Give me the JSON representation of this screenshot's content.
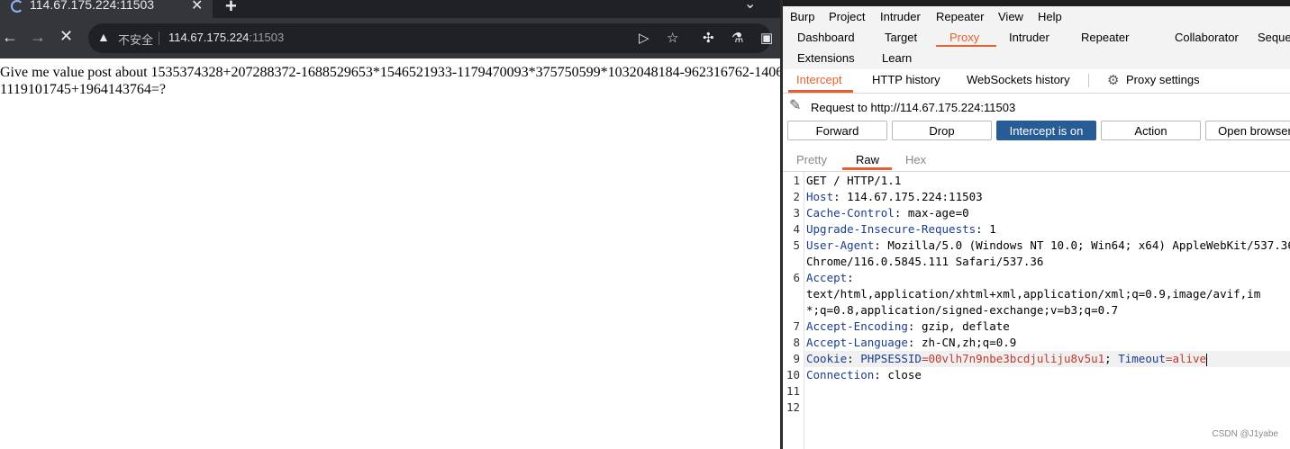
{
  "browser": {
    "tab": {
      "title": "114.67.175.224:11503"
    },
    "new_tab_label": "+",
    "tab_menu_label": "⌄",
    "toolbar": {
      "back_label": "←",
      "forward_label": "→",
      "stop_label": "✕"
    },
    "omnibox": {
      "security_label": "不安全",
      "url_host": "114.67.175.224",
      "url_port": ":11503"
    },
    "page": {
      "challenge_line1": "Give me value post about 1535374328+207288372-1688529653*1546521933-1179470093*375750599*1032048184-962316762-1406",
      "challenge_line2": "1119101745+1964143764=?"
    }
  },
  "burp": {
    "menu": [
      "Burp",
      "Project",
      "Intruder",
      "Repeater",
      "View",
      "Help"
    ],
    "tools_row1": [
      "Dashboard",
      "Target",
      "Proxy",
      "Intruder",
      "Repeater",
      "Collaborator",
      "Seque"
    ],
    "tools_row2": [
      "Extensions",
      "Learn"
    ],
    "active_tool": "Proxy",
    "proxy_tabs": [
      "Intercept",
      "HTTP history",
      "WebSockets history"
    ],
    "proxy_settings_label": "Proxy settings",
    "request_label": "Request to http://114.67.175.224:11503",
    "buttons": {
      "forward": "Forward",
      "drop": "Drop",
      "intercept": "Intercept is on",
      "action": "Action",
      "open_browser": "Open browser"
    },
    "view_tabs": [
      "Pretty",
      "Raw",
      "Hex"
    ],
    "lines": [
      {
        "n": "1",
        "name": "",
        "sep": "",
        "value": "GET / HTTP/1.1"
      },
      {
        "n": "2",
        "name": "Host",
        "sep": ":",
        "value": " 114.67.175.224:11503"
      },
      {
        "n": "3",
        "name": "Cache-Control",
        "sep": ":",
        "value": " max-age=0"
      },
      {
        "n": "4",
        "name": "Upgrade-Insecure-Requests",
        "sep": ":",
        "value": " 1"
      },
      {
        "n": "5",
        "name": "User-Agent",
        "sep": ":",
        "value": " Mozilla/5.0 (Windows NT 10.0; Win64; x64) AppleWebKit/537.36"
      },
      {
        "n": "",
        "name": "",
        "sep": "",
        "value": "Chrome/116.0.5845.111 Safari/537.36"
      },
      {
        "n": "6",
        "name": "Accept",
        "sep": ":",
        "value": ""
      },
      {
        "n": "",
        "name": "",
        "sep": "",
        "value": "text/html,application/xhtml+xml,application/xml;q=0.9,image/avif,im"
      },
      {
        "n": "",
        "name": "",
        "sep": "",
        "value": "*;q=0.8,application/signed-exchange;v=b3;q=0.7"
      },
      {
        "n": "7",
        "name": "Accept-Encoding",
        "sep": ":",
        "value": " gzip, deflate"
      },
      {
        "n": "8",
        "name": "Accept-Language",
        "sep": ":",
        "value": " zh-CN,zh;q=0.9"
      },
      {
        "n": "9",
        "name": "Cookie",
        "sep": ":",
        "value": ""
      },
      {
        "n": "10",
        "name": "Connection",
        "sep": ":",
        "value": " close"
      },
      {
        "n": "11",
        "name": "",
        "sep": "",
        "value": ""
      },
      {
        "n": "12",
        "name": "",
        "sep": "",
        "value": ""
      }
    ],
    "cookie": {
      "name1": "PHPSESSID",
      "value1": "00vlh7n9nbe3bcdjuliju8v5u1",
      "name2": "Timeout",
      "value2": "alive"
    },
    "watermark": "CSDN @J1yabe"
  }
}
